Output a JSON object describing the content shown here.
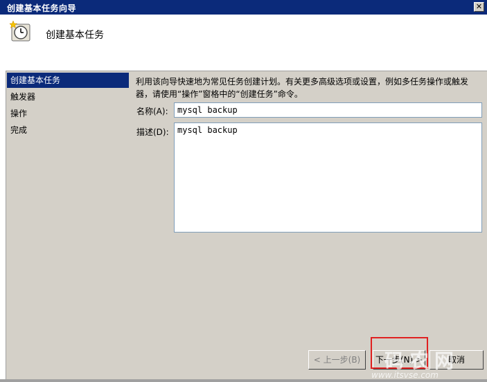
{
  "window": {
    "title": "创建基本任务向导",
    "close_glyph": "✕"
  },
  "header": {
    "title": "创建基本任务",
    "icon": "clock-star-icon"
  },
  "nav": {
    "items": [
      {
        "label": "创建基本任务",
        "active": true
      },
      {
        "label": "触发器",
        "active": false
      },
      {
        "label": "操作",
        "active": false
      },
      {
        "label": "完成",
        "active": false
      }
    ]
  },
  "main": {
    "description": "利用该向导快速地为常见任务创建计划。有关更多高级选项或设置，例如多任务操作或触发器，请使用“操作”窗格中的“创建任务”命令。",
    "name_label": "名称(A):",
    "name_value": "mysql backup",
    "desc_label": "描述(D):",
    "desc_value": "mysql backup"
  },
  "buttons": {
    "back": "< 上一步(B)",
    "next": "下一步(N) >",
    "cancel": "取消"
  },
  "watermark": {
    "text": "码农网",
    "url": "www.itsvse.com"
  },
  "colors": {
    "title_bar": "#0b2a7a",
    "highlight": "#e02020",
    "background": "#d4d0c8"
  }
}
